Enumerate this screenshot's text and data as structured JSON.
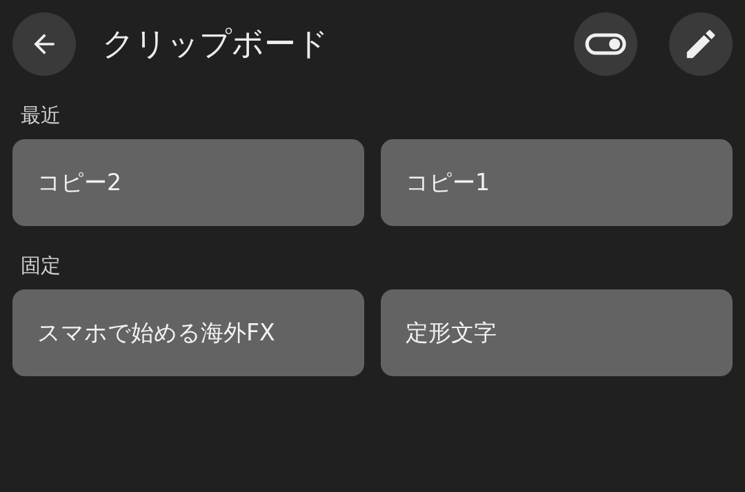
{
  "header": {
    "title": "クリップボード"
  },
  "sections": [
    {
      "label": "最近",
      "items": [
        {
          "text": "コピー2"
        },
        {
          "text": "コピー1"
        }
      ]
    },
    {
      "label": "固定",
      "items": [
        {
          "text": "スマホで始める海外FX"
        },
        {
          "text": "定形文字"
        }
      ]
    }
  ]
}
